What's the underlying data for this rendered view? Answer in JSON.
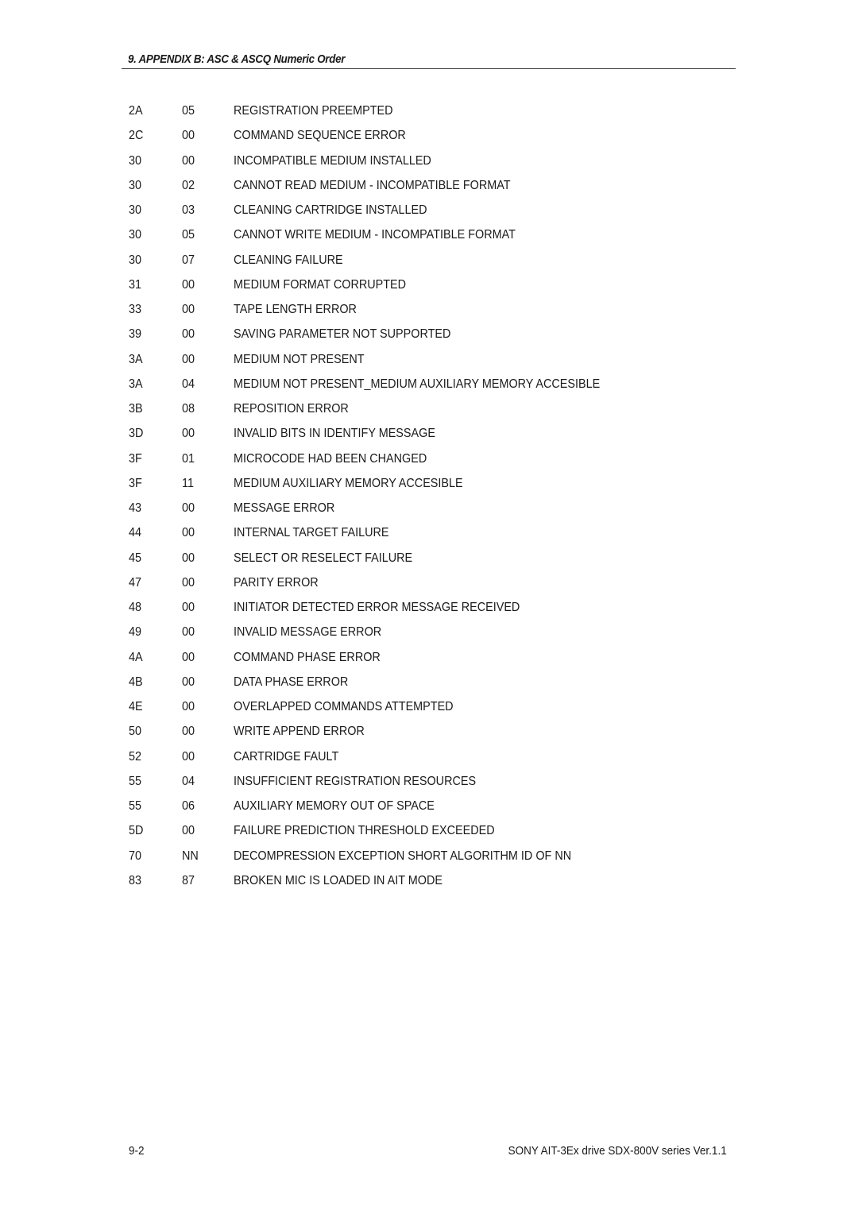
{
  "header": {
    "title": "9. APPENDIX B: ASC & ASCQ Numeric Order"
  },
  "rows": [
    {
      "asc": "2A",
      "ascq": "05",
      "description": "REGISTRATION PREEMPTED"
    },
    {
      "asc": "2C",
      "ascq": "00",
      "description": "COMMAND SEQUENCE ERROR"
    },
    {
      "asc": "30",
      "ascq": "00",
      "description": "INCOMPATIBLE MEDIUM INSTALLED"
    },
    {
      "asc": "30",
      "ascq": "02",
      "description": "CANNOT READ MEDIUM - INCOMPATIBLE FORMAT"
    },
    {
      "asc": "30",
      "ascq": "03",
      "description": "CLEANING CARTRIDGE INSTALLED"
    },
    {
      "asc": "30",
      "ascq": "05",
      "description": "CANNOT WRITE MEDIUM - INCOMPATIBLE FORMAT"
    },
    {
      "asc": "30",
      "ascq": "07",
      "description": "CLEANING FAILURE"
    },
    {
      "asc": "31",
      "ascq": "00",
      "description": "MEDIUM FORMAT CORRUPTED"
    },
    {
      "asc": "33",
      "ascq": "00",
      "description": "TAPE LENGTH ERROR"
    },
    {
      "asc": "39",
      "ascq": "00",
      "description": "SAVING PARAMETER NOT SUPPORTED"
    },
    {
      "asc": "3A",
      "ascq": "00",
      "description": "MEDIUM NOT PRESENT"
    },
    {
      "asc": "3A",
      "ascq": "04",
      "description": "MEDIUM NOT PRESENT_MEDIUM AUXILIARY MEMORY ACCESIBLE"
    },
    {
      "asc": "3B",
      "ascq": "08",
      "description": "REPOSITION ERROR"
    },
    {
      "asc": "3D",
      "ascq": "00",
      "description": "INVALID BITS IN IDENTIFY MESSAGE"
    },
    {
      "asc": "3F",
      "ascq": "01",
      "description": "MICROCODE HAD BEEN CHANGED"
    },
    {
      "asc": "3F",
      "ascq": "11",
      "description": "MEDIUM AUXILIARY MEMORY ACCESIBLE"
    },
    {
      "asc": "43",
      "ascq": "00",
      "description": "MESSAGE ERROR"
    },
    {
      "asc": "44",
      "ascq": "00",
      "description": "INTERNAL TARGET FAILURE"
    },
    {
      "asc": "45",
      "ascq": "00",
      "description": "SELECT OR RESELECT FAILURE"
    },
    {
      "asc": "47",
      "ascq": "00",
      "description": "PARITY ERROR"
    },
    {
      "asc": "48",
      "ascq": "00",
      "description": "INITIATOR DETECTED ERROR MESSAGE RECEIVED"
    },
    {
      "asc": "49",
      "ascq": "00",
      "description": "INVALID MESSAGE ERROR"
    },
    {
      "asc": "4A",
      "ascq": "00",
      "description": "COMMAND PHASE ERROR"
    },
    {
      "asc": "4B",
      "ascq": "00",
      "description": "DATA PHASE ERROR"
    },
    {
      "asc": "4E",
      "ascq": "00",
      "description": "OVERLAPPED COMMANDS ATTEMPTED"
    },
    {
      "asc": "50",
      "ascq": "00",
      "description": "WRITE APPEND ERROR"
    },
    {
      "asc": "52",
      "ascq": "00",
      "description": "CARTRIDGE FAULT"
    },
    {
      "asc": "55",
      "ascq": "04",
      "description": "INSUFFICIENT REGISTRATION RESOURCES"
    },
    {
      "asc": "55",
      "ascq": "06",
      "description": "AUXILIARY MEMORY OUT OF SPACE"
    },
    {
      "asc": "5D",
      "ascq": "00",
      "description": "FAILURE PREDICTION THRESHOLD EXCEEDED"
    },
    {
      "asc": "70",
      "ascq": "NN",
      "description": "DECOMPRESSION EXCEPTION SHORT ALGORITHM ID OF NN"
    },
    {
      "asc": "83",
      "ascq": "87",
      "description": "BROKEN MIC IS LOADED IN AIT MODE"
    }
  ],
  "footer": {
    "page_number": "9-2",
    "document_title": "SONY AIT-3Ex drive SDX-800V series Ver.1.1"
  }
}
